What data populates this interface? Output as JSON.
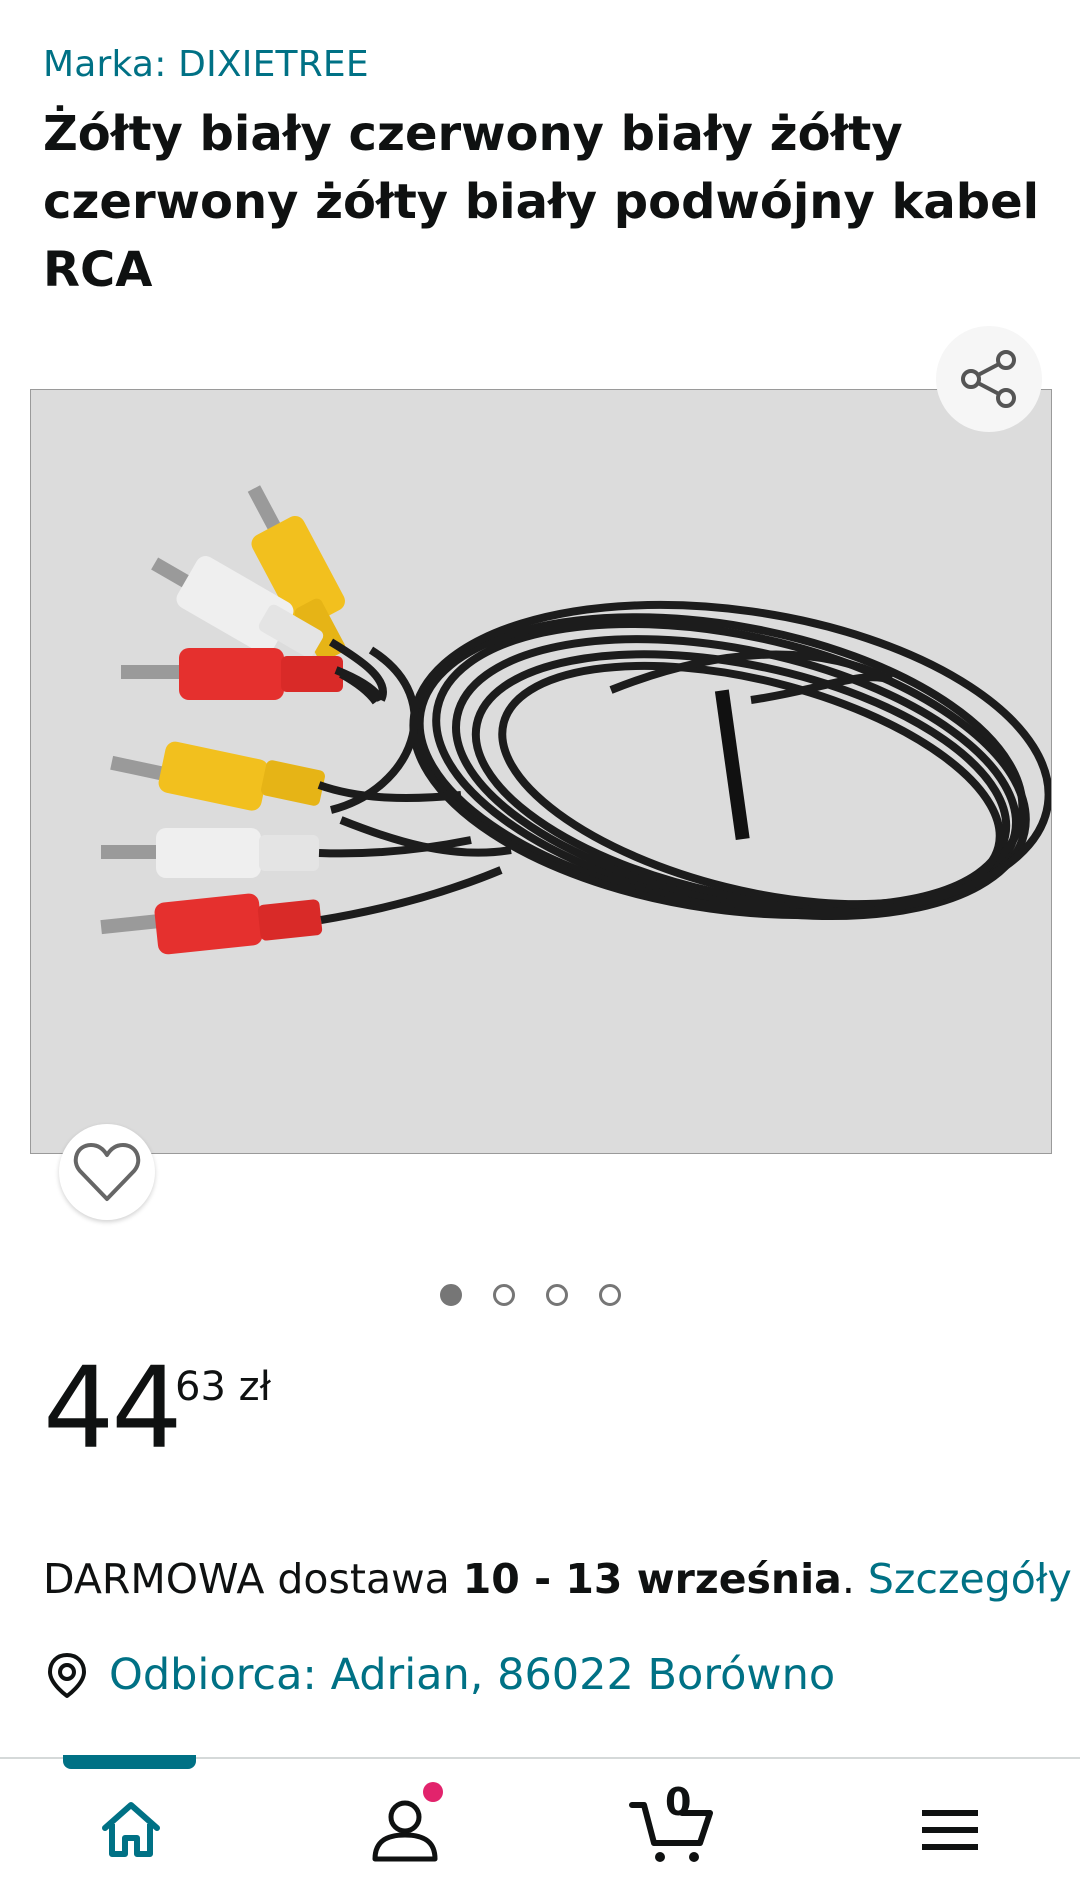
{
  "product": {
    "brand": "Marka: DIXIETREE",
    "title": "Żółty biały czerwony biały żółty czerwony żółty biały podwójny kabel RCA",
    "image_count": 4,
    "active_image": 1
  },
  "price": {
    "whole": "44",
    "fraction_currency": "63 zł"
  },
  "delivery": {
    "prefix": "DARMOWA dostawa ",
    "dates": "10 - 13 września",
    "separator": ". ",
    "details_link": "Szczegóły"
  },
  "recipient": {
    "label": "Odbiorca: Adrian, 86022 Borówno"
  },
  "bottom_nav": {
    "cart_count": "0",
    "icons": [
      "home-icon",
      "account-icon",
      "cart-icon",
      "menu-icon"
    ]
  },
  "colors": {
    "link": "#007185",
    "accent_badge": "#e2236c",
    "text": "#0f1111"
  }
}
